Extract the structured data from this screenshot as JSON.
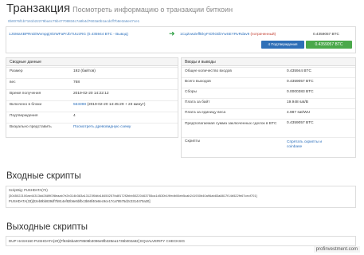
{
  "header": {
    "title": "Транзакция",
    "subtitle": "Посмотреть информацию о транзакции биткоин",
    "tx_hash": "0b0076f1b7161b22279ba4c75b47708834c7a9b4d7603a0b1acdcff7b8e3a6e47ce1"
  },
  "tx": {
    "input_address": "1JSMaXBPRnDiWvmppjXkrWFaPrJbTUUzRG (0.435944 BTC - Вывод)",
    "output_address": "1CqZvwZeffEkyFrDhGtibYwSEYRvRdav9",
    "output_tag": "(потраченный)",
    "output_value": "0.4359057 BTC",
    "confirmations_button": "4 Подтверждения",
    "amount_button": "0.4359057 BTC"
  },
  "summary": {
    "heading": "Сводные данные",
    "rows": [
      {
        "key": "Размер",
        "value": "192 (байтов)"
      },
      {
        "key": "вес",
        "value": "768"
      },
      {
        "key": "Время получения",
        "value": "2019-02-20 14:22:12"
      },
      {
        "key": "Включено в блоки",
        "link": "563398",
        "value": "(2019-02-20 14:45:29 + 23 минут)"
      },
      {
        "key": "Подтверждения",
        "value": "4"
      },
      {
        "key": "Визуально представить",
        "value": "Посмотреть древовидную схему"
      }
    ]
  },
  "io": {
    "heading": "Вводы и выводы",
    "rows": [
      {
        "key": "Общее количество входов",
        "value": "0.435944 BTC"
      },
      {
        "key": "Всего выходов",
        "value": "0.4359057 BTC"
      },
      {
        "key": "Сборы",
        "value": "0.0000383 BTC"
      },
      {
        "key": "Плата за байт",
        "value": "19.948 sat/B"
      },
      {
        "key": "Плата за единицу веса",
        "value": "4.987 sat/WU"
      },
      {
        "key": "Предполагаемая сумма заключенных сделок в BTC",
        "value": "0.4359057 BTC"
      },
      {
        "key": "Скрипты",
        "value": "Спрятать скрипты и coinbase"
      }
    ]
  },
  "input_scripts": {
    "heading": "Входные скрипты",
    "line1": "ScriptSig: PUSHDATA(72)",
    "line2": "[3045022100ae44313dd2689f2f8eaab7e2b314b383a13123f0dfa18450257fa8f172f2bbb50220463755ca1d530b19fedb06eb5cab241930b40a96ab83a8817f14b522fe67cecf701]",
    "line3": "PUSHDATA(33)[02eb9bb839df7b814ef82b6e5bfbc3b66f40e8ec9ce17ca78575d2c3314470a30]"
  },
  "output_scripts": {
    "heading": "Выходные скрипты",
    "line1": "DUP HASH160 PUSHDATA(20)[7f63d6ba0078508b3096e9fb328ea1735b002a92] EQUALVERIFY CHECKSIG"
  },
  "watermark": "profinvestment.com"
}
